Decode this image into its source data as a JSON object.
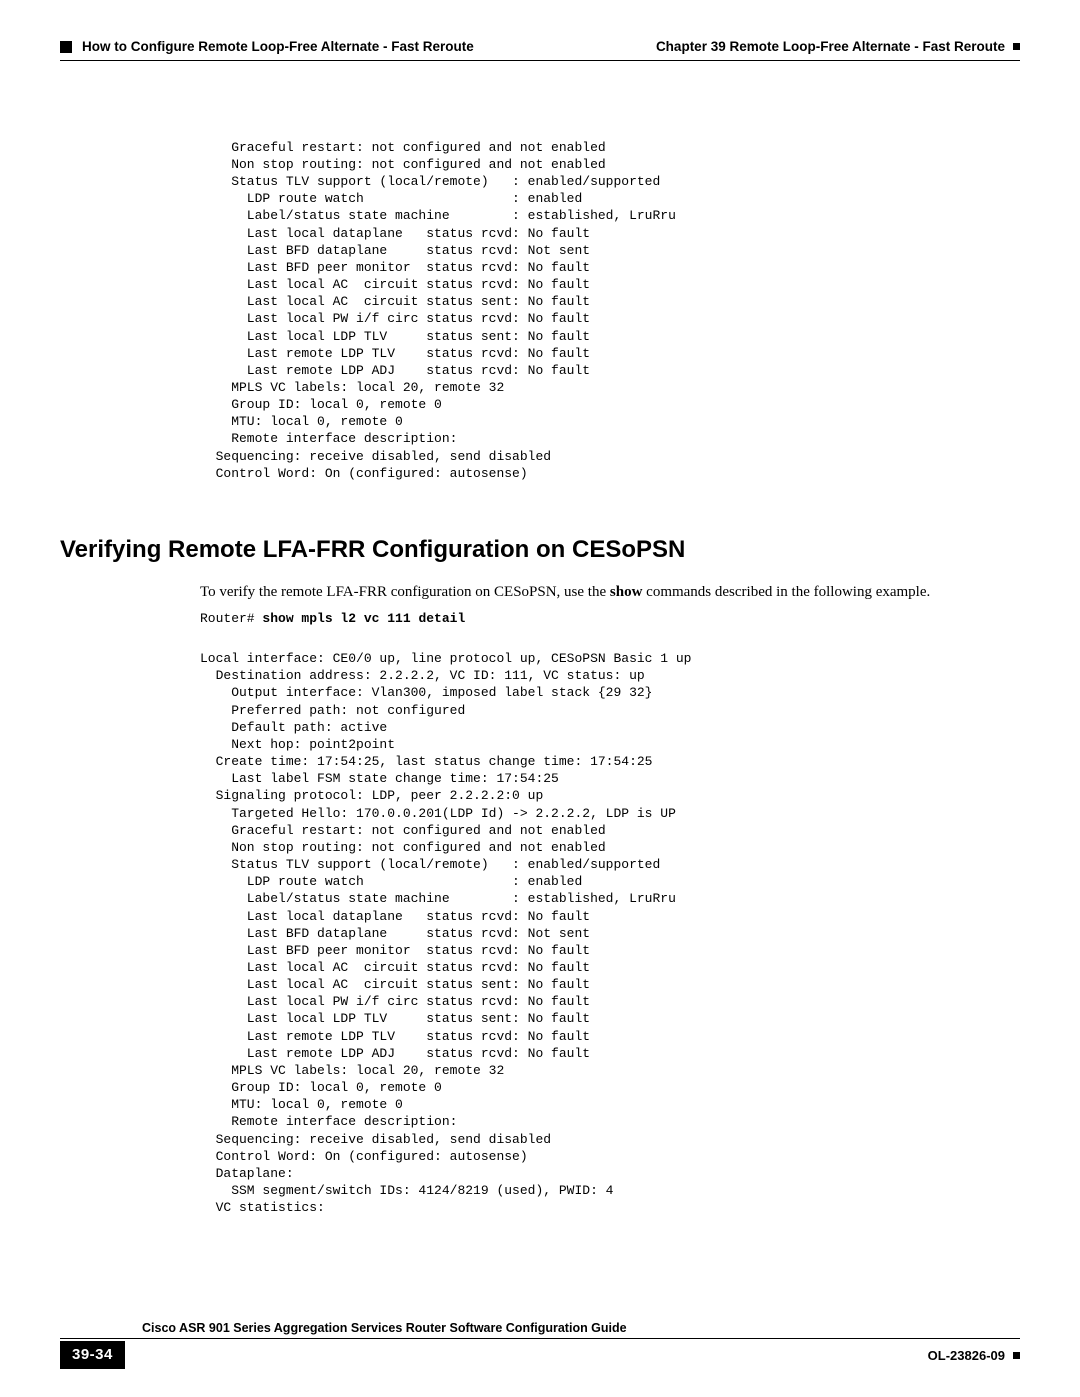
{
  "header": {
    "chapter": "Chapter 39    Remote Loop-Free Alternate - Fast Reroute",
    "section": "How to Configure Remote Loop-Free Alternate - Fast Reroute"
  },
  "code_block1": "    Graceful restart: not configured and not enabled\n    Non stop routing: not configured and not enabled\n    Status TLV support (local/remote)   : enabled/supported\n      LDP route watch                   : enabled\n      Label/status state machine        : established, LruRru\n      Last local dataplane   status rcvd: No fault\n      Last BFD dataplane     status rcvd: Not sent\n      Last BFD peer monitor  status rcvd: No fault\n      Last local AC  circuit status rcvd: No fault\n      Last local AC  circuit status sent: No fault\n      Last local PW i/f circ status rcvd: No fault\n      Last local LDP TLV     status sent: No fault\n      Last remote LDP TLV    status rcvd: No fault\n      Last remote LDP ADJ    status rcvd: No fault\n    MPLS VC labels: local 20, remote 32\n    Group ID: local 0, remote 0\n    MTU: local 0, remote 0\n    Remote interface description:\n  Sequencing: receive disabled, send disabled\n  Control Word: On (configured: autosense)",
  "section_heading": "Verifying Remote LFA-FRR Configuration on CESoPSN",
  "section_body_a": "To verify the remote LFA-FRR configuration on CESoPSN, use the ",
  "section_body_bold": "show",
  "section_body_b": " commands described in the following example.",
  "cmd_prompt": "Router# ",
  "cmd_bold": "show mpls l2 vc 111 detail",
  "code_block2": "\nLocal interface: CE0/0 up, line protocol up, CESoPSN Basic 1 up\n  Destination address: 2.2.2.2, VC ID: 111, VC status: up\n    Output interface: Vlan300, imposed label stack {29 32}\n    Preferred path: not configured\n    Default path: active\n    Next hop: point2point\n  Create time: 17:54:25, last status change time: 17:54:25\n    Last label FSM state change time: 17:54:25\n  Signaling protocol: LDP, peer 2.2.2.2:0 up\n    Targeted Hello: 170.0.0.201(LDP Id) -> 2.2.2.2, LDP is UP\n    Graceful restart: not configured and not enabled\n    Non stop routing: not configured and not enabled\n    Status TLV support (local/remote)   : enabled/supported\n      LDP route watch                   : enabled\n      Label/status state machine        : established, LruRru\n      Last local dataplane   status rcvd: No fault\n      Last BFD dataplane     status rcvd: Not sent\n      Last BFD peer monitor  status rcvd: No fault\n      Last local AC  circuit status rcvd: No fault\n      Last local AC  circuit status sent: No fault\n      Last local PW i/f circ status rcvd: No fault\n      Last local LDP TLV     status sent: No fault\n      Last remote LDP TLV    status rcvd: No fault\n      Last remote LDP ADJ    status rcvd: No fault\n    MPLS VC labels: local 20, remote 32\n    Group ID: local 0, remote 0\n    MTU: local 0, remote 0\n    Remote interface description:\n  Sequencing: receive disabled, send disabled\n  Control Word: On (configured: autosense)\n  Dataplane:\n    SSM segment/switch IDs: 4124/8219 (used), PWID: 4\n  VC statistics:",
  "footer": {
    "guide": "Cisco ASR 901 Series Aggregation Services Router Software Configuration Guide",
    "page": "39-34",
    "doc_id": "OL-23826-09"
  }
}
